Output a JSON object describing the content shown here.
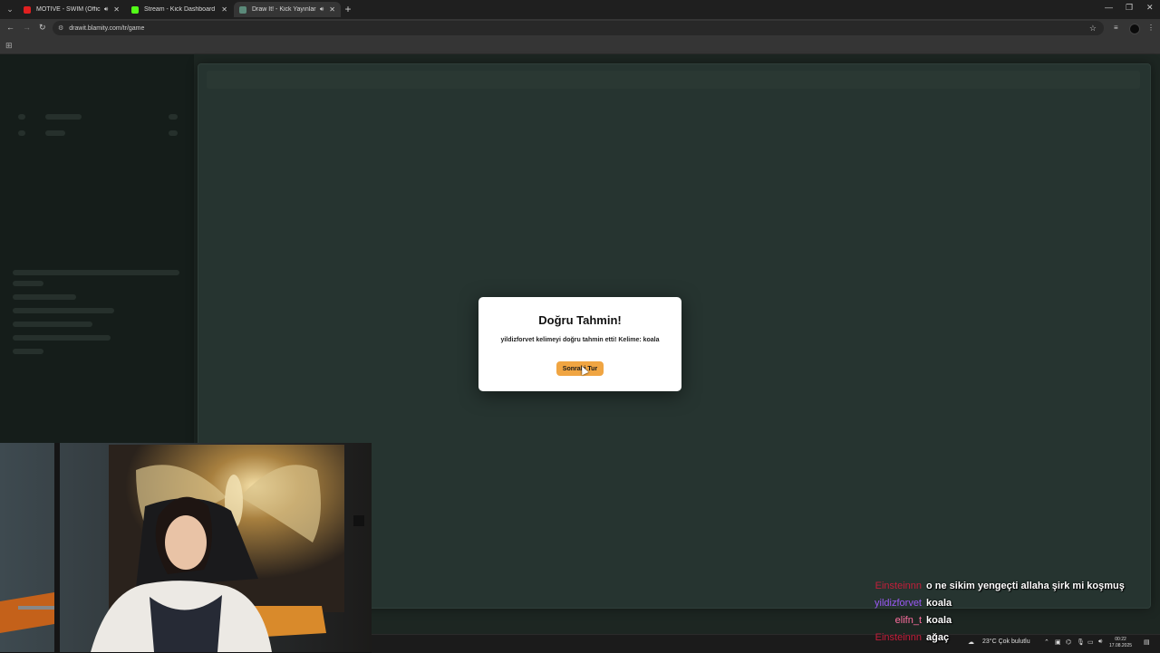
{
  "browser": {
    "tabs": [
      {
        "title": "MOTIVE - SWIM (Official M",
        "favicon_color": "#e02020",
        "audio": true,
        "active": false
      },
      {
        "title": "Stream - Kick Dashboard",
        "favicon_color": "#53fc18",
        "audio": false,
        "active": false
      },
      {
        "title": "Draw It! - Kick Yayınları İçin",
        "favicon_color": "#5b8a7a",
        "audio": true,
        "active": true
      }
    ],
    "address": "drawit.blamity.com/tr/game"
  },
  "modal": {
    "title": "Doğru Tahmin!",
    "message": "yildizforvet kelimeyi doğru tahmin etti! Kelime: koala",
    "next_button": "Sonraki Tur",
    "button_color": "#f0a542"
  },
  "chat": [
    {
      "user": "Einsteinnn",
      "color": "#c41e3a",
      "text": "o ne sikim yengeçti allaha şirk mi koşmuş"
    },
    {
      "user": "yildizforvet",
      "color": "#9b59f5",
      "text": "koala"
    },
    {
      "user": "elifn_t",
      "color": "#ff6fa0",
      "text": "koala"
    },
    {
      "user": "Einsteinnn",
      "color": "#c41e3a",
      "text": "ağaç"
    }
  ],
  "taskbar": {
    "weather": "23°C  Çok bulutlu",
    "time": "00:22",
    "date": "17.08.2025"
  }
}
